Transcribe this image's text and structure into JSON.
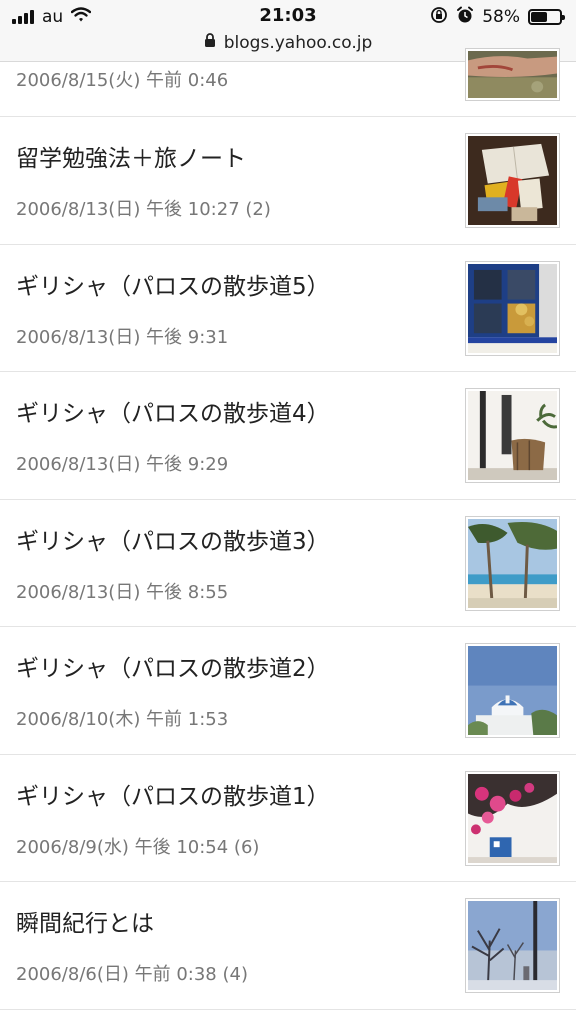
{
  "status_bar": {
    "carrier": "au",
    "time": "21:03",
    "battery": "58%",
    "battery_level": 0.58,
    "url": "blogs.yahoo.co.jp"
  },
  "posts": [
    {
      "title": "",
      "date": "2006/8/15(火) 午前 0:46",
      "thumb": "hand-photo"
    },
    {
      "title": "留学勉強法＋旅ノート",
      "date": "2006/8/13(日) 午後 10:27 (2)",
      "thumb": "notebooks-photo"
    },
    {
      "title": "ギリシャ（パロスの散歩道5）",
      "date": "2006/8/13(日) 午後 9:31",
      "thumb": "window-photo"
    },
    {
      "title": "ギリシャ（パロスの散歩道4）",
      "date": "2006/8/13(日) 午後 9:29",
      "thumb": "terrace-photo"
    },
    {
      "title": "ギリシャ（パロスの散歩道3）",
      "date": "2006/8/13(日) 午後 8:55",
      "thumb": "beach-photo"
    },
    {
      "title": "ギリシャ（パロスの散歩道2）",
      "date": "2006/8/10(木) 午前 1:53",
      "thumb": "church-photo"
    },
    {
      "title": "ギリシャ（パロスの散歩道1）",
      "date": "2006/8/9(水) 午後 10:54 (6)",
      "thumb": "bougainvillea-photo"
    },
    {
      "title": "瞬間紀行とは",
      "date": "2006/8/6(日) 午前 0:38 (4)",
      "thumb": "winter-trees-photo"
    }
  ]
}
